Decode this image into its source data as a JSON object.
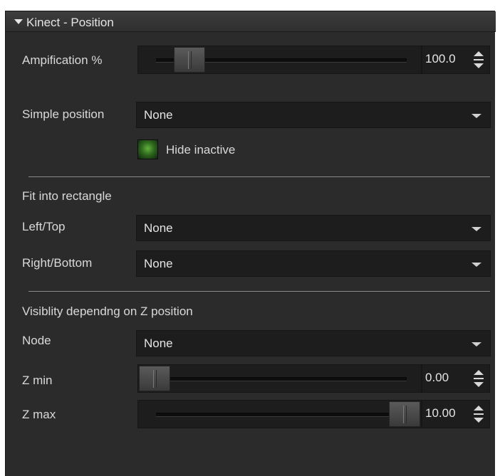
{
  "panel": {
    "title": "Kinect - Position",
    "amplification": {
      "label": "Ampification %",
      "value": "100.0",
      "slider_fraction": 0.14
    },
    "simple_position": {
      "label": "Simple position",
      "value": "None"
    },
    "hide_inactive": {
      "label": "Hide inactive",
      "checked": true
    },
    "fit_section": {
      "title": "Fit into rectangle"
    },
    "left_top": {
      "label": "Left/Top",
      "value": "None"
    },
    "right_bottom": {
      "label": "Right/Bottom",
      "value": "None"
    },
    "z_section": {
      "title": "Visiblity dependng on Z position"
    },
    "node": {
      "label": "Node",
      "value": "None"
    },
    "z_min": {
      "label": "Z min",
      "value": "0.00",
      "slider_fraction": 0.0
    },
    "z_max": {
      "label": "Z max",
      "value": "10.00",
      "slider_fraction": 1.0
    }
  },
  "colors": {
    "panel_bg": "#2b2b2b",
    "field_bg": "#1d1d1d",
    "text": "#d9d9d9",
    "check_green": "#63b03f"
  },
  "icons": [
    "triangle-down-icon",
    "dropdown-arrow-icon",
    "spin-up-icon",
    "spin-down-icon",
    "checkbox-checked-icon"
  ]
}
